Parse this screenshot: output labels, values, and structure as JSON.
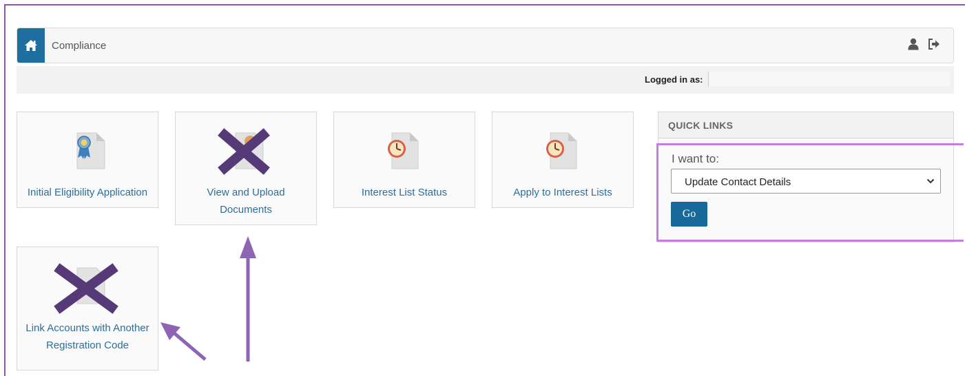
{
  "header": {
    "home_icon": "home-icon",
    "breadcrumb": "Compliance",
    "user_icon": "user-icon",
    "logout_icon": "logout-icon"
  },
  "login": {
    "label": "Logged in as:",
    "value": ""
  },
  "tiles": [
    {
      "label_line1": "Initial Eligibility Application",
      "label_line2": "",
      "icon": "award-document-icon",
      "crossed_out": false
    },
    {
      "label_line1": "View and Upload",
      "label_line2": "Documents",
      "icon": "document-icon",
      "crossed_out": true
    },
    {
      "label_line1": "Interest List Status",
      "label_line2": "",
      "icon": "clock-document-icon",
      "crossed_out": false
    },
    {
      "label_line1": "Apply to Interest Lists",
      "label_line2": "",
      "icon": "clock-document-icon",
      "crossed_out": false
    },
    {
      "label_line1": "Link Accounts with Another",
      "label_line2": "Registration Code",
      "icon": "document-icon",
      "crossed_out": true
    }
  ],
  "quick_links": {
    "title": "QUICK LINKS",
    "label": "I want to:",
    "selected": "Update Contact Details",
    "go_label": "Go"
  },
  "colors": {
    "primary": "#1e6fa0",
    "link": "#2d6e9c",
    "annotation_purple": "#8e55a8",
    "highlight_purple": "#c47ee0",
    "cross": "#563a78"
  }
}
